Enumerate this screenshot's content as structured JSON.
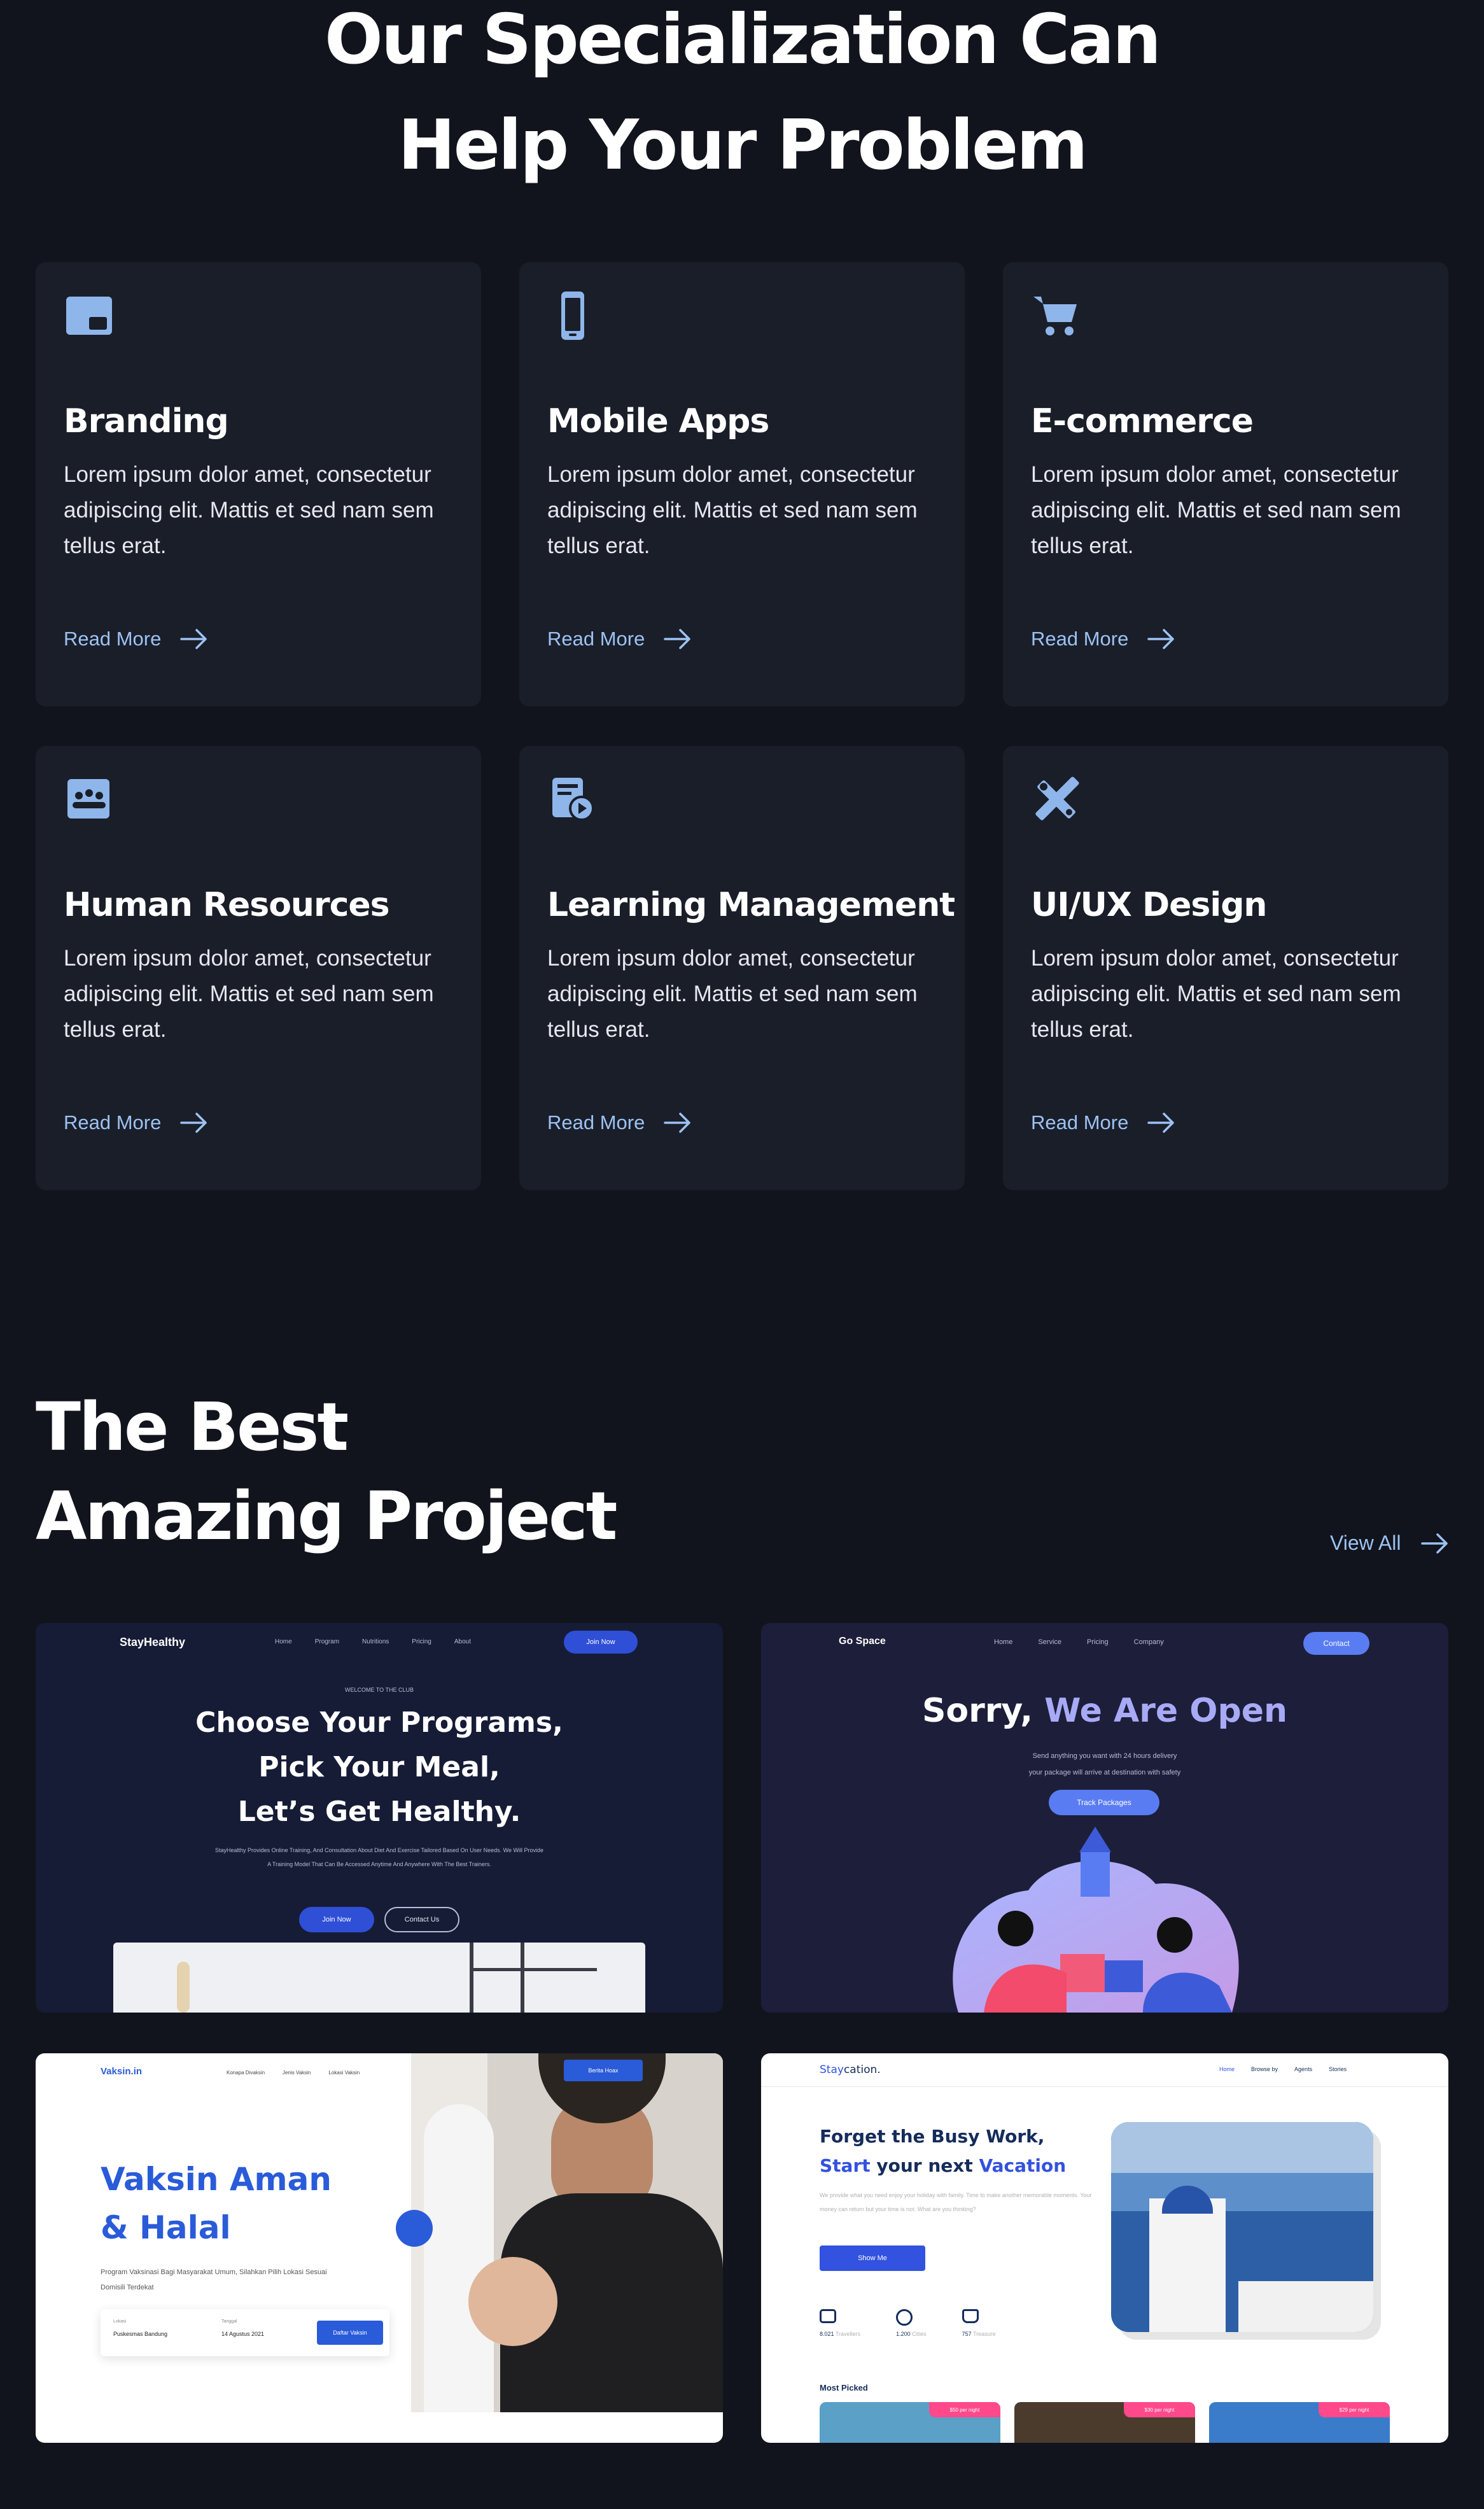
{
  "hero": {
    "line1": "Our Specialization Can",
    "line2": "Help Your Problem"
  },
  "services": [
    {
      "icon": "branding-icon",
      "title": "Branding",
      "text": "Lorem ipsum dolor amet, consectetur adipiscing elit. Mattis et sed nam sem tellus erat.",
      "cta": "Read More"
    },
    {
      "icon": "mobile-phone-icon",
      "title": "Mobile Apps",
      "text": "Lorem ipsum dolor amet, consectetur adipiscing elit. Mattis et sed nam sem tellus erat.",
      "cta": "Read More"
    },
    {
      "icon": "shopping-cart-icon",
      "title": "E-commerce",
      "text": "Lorem ipsum dolor amet, consectetur adipiscing elit. Mattis et sed nam sem tellus erat.",
      "cta": "Read More"
    },
    {
      "icon": "people-icon",
      "title": "Human Resources",
      "text": "Lorem ipsum dolor amet, consectetur adipiscing elit. Mattis et sed nam sem tellus erat.",
      "cta": "Read More"
    },
    {
      "icon": "video-lesson-icon",
      "title": "Learning Management",
      "text": "Lorem ipsum dolor amet, consectetur adipiscing elit. Mattis et sed nam sem tellus erat.",
      "cta": "Read More"
    },
    {
      "icon": "design-tools-icon",
      "title": "UI/UX Design",
      "text": "Lorem ipsum dolor amet, consectetur adipiscing elit. Mattis et sed nam sem tellus erat.",
      "cta": "Read More"
    }
  ],
  "projects_section": {
    "line1": "The Best",
    "line2": "Amazing Project",
    "view_all": "View All"
  },
  "projects": {
    "stayhealthy": {
      "brand": "StayHealthy",
      "nav": [
        "Home",
        "Program",
        "Nutritions",
        "Pricing",
        "About"
      ],
      "cta": "Join Now",
      "eyebrow": "WELCOME TO THE CLUB",
      "headline1": "Choose Your Programs,",
      "headline2": "Pick Your Meal,",
      "headline3": "Let’s Get Healthy.",
      "body": "StayHealthy Provides Online Training, And Consultation About Diet And Exercise Tailored Based On User Needs. We Will Provide A Training Model That Can Be Accessed Anytime And Anywhere With The Best Trainers.",
      "primary": "Join Now",
      "secondary": "Contact Us"
    },
    "gospace": {
      "brand": "Go Space",
      "nav": [
        "Home",
        "Service",
        "Pricing",
        "Company"
      ],
      "cta": "Contact",
      "headline_a": "Sorry,",
      "headline_b": "We Are Open",
      "sub1": "Send anything you want with 24 hours delivery",
      "sub2": "your package will arrive at destination with safety",
      "button": "Track Packages"
    },
    "vaksin": {
      "brand": "Vaksin.in",
      "nav": [
        "Konapa Divaksin",
        "Jenis Vaksin",
        "Lokasi Vaksin"
      ],
      "cta": "Berita Hoax",
      "headline1": "Vaksin Aman",
      "headline2": "& Halal",
      "body": "Program Vaksinasi Bagi Masyarakat Umum, Silahkan Pilih Lokasi Sesuai Domisili Terdekat",
      "field1_label": "Lokasi",
      "field1_value": "Puskesmas Bandung",
      "field2_label": "Tanggal",
      "field2_value": "14 Agustus 2021",
      "button": "Daftar Vaksin"
    },
    "staycation": {
      "brand_a": "Stay",
      "brand_b": "cation.",
      "nav": [
        "Home",
        "Browse by",
        "Agents",
        "Stories"
      ],
      "headline1": "Forget the Busy Work,",
      "headline2a": "Start",
      "headline2b": " your next ",
      "headline2c": "Vacation",
      "body": "We provide what you need enjoy your holiday with family. Time to make another memorable moments. Your money can return but your time is not. What are you thinking?",
      "button": "Show Me",
      "stats": [
        {
          "num": "8.021",
          "label": "Travellers"
        },
        {
          "num": "1.200",
          "label": "Cities"
        },
        {
          "num": "757",
          "label": "Treasure"
        }
      ],
      "most_picked": "Most Picked",
      "prices": [
        "$50 per night",
        "$30 per night",
        "$29 per night"
      ]
    }
  },
  "colors": {
    "bg": "#11141c",
    "card": "#1a1e29",
    "accent": "#9cc2f2",
    "icon": "#8fb6ea"
  }
}
